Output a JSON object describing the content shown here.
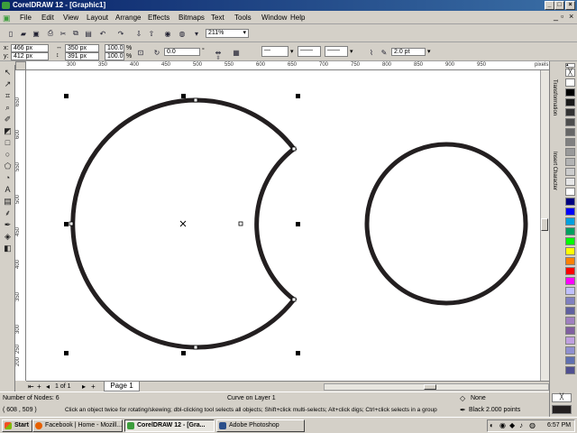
{
  "window": {
    "title": "CorelDRAW 12 - [Graphic1]"
  },
  "menu": [
    "File",
    "Edit",
    "View",
    "Layout",
    "Arrange",
    "Effects",
    "Bitmaps",
    "Text",
    "Tools",
    "Window",
    "Help"
  ],
  "toolbar": {
    "zoom": "211%"
  },
  "property_bar": {
    "x": "466 px",
    "y": "412 px",
    "width": "350 px",
    "height": "391 px",
    "scale_x": "100.0",
    "scale_y": "100.0",
    "scale_unit": "%",
    "rotation": "0.0",
    "rotation_unit": "°",
    "outline_width": "2.0 pt"
  },
  "rulers": {
    "h_unit": "pixels",
    "v_unit": "pixels",
    "h_ticks": [
      "300",
      "350",
      "400",
      "450",
      "500",
      "550",
      "600",
      "650",
      "700",
      "750",
      "800",
      "850",
      "900",
      "950"
    ],
    "v_ticks": [
      "650",
      "600",
      "550",
      "500",
      "450",
      "400",
      "350",
      "300",
      "250",
      "200"
    ]
  },
  "dockers": {
    "tab1": "Transformation",
    "tab2": "Insert Character"
  },
  "palette": [
    "#ffffff",
    "#000000",
    "#1a1a1a",
    "#333333",
    "#4d4d4d",
    "#666666",
    "#808080",
    "#999999",
    "#b3b3b3",
    "#cccccc",
    "#e6e6e6",
    "#ffffff",
    "#000080",
    "#0000ff",
    "#00a0e0",
    "#00a060",
    "#00ff00",
    "#ffff00",
    "#ff8000",
    "#ff0000",
    "#ff00ff",
    "#c0c0ff",
    "#8080c0",
    "#6060a0",
    "#a080c0",
    "#8060a0",
    "#c0a0e0",
    "#9090d0",
    "#6070b0",
    "#505090"
  ],
  "page_nav": {
    "counter": "1 of 1",
    "page_tab": "Page 1"
  },
  "status": {
    "nodes": "Number of Nodes: 6",
    "layer": "Curve on Layer 1",
    "coords": "( 608 , 509 )",
    "hint": "Click an object twice for rotating/skewing; dbl-clicking tool selects all objects; Shift+click multi-selects; Alt+click digs; Ctrl+click selects in a group",
    "fill": "None",
    "outline": "Black  2.000 points"
  },
  "taskbar": {
    "start": "Start",
    "tasks": [
      "Facebook | Home - Mozill...",
      "CorelDRAW 12 - [Gra...",
      "Adobe Photoshop"
    ],
    "clock": "6:57 PM"
  }
}
